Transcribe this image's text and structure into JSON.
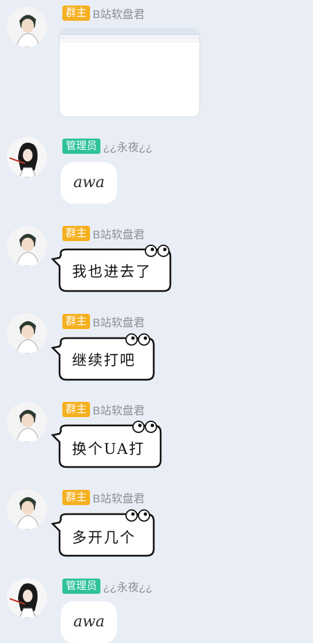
{
  "labels": {
    "owner": "群主",
    "admin": "管理员"
  },
  "users": {
    "owner_name": "B站软盘君",
    "admin_name": "¿¿永夜¿¿"
  },
  "messages": [
    {
      "id": "m1",
      "role": "owner",
      "type": "image"
    },
    {
      "id": "m2",
      "role": "admin",
      "type": "text",
      "text": "awa"
    },
    {
      "id": "m3",
      "role": "owner",
      "type": "sticker-bubble",
      "text": "我也进去了"
    },
    {
      "id": "m4",
      "role": "owner",
      "type": "sticker-bubble",
      "text": "继续打吧"
    },
    {
      "id": "m5",
      "role": "owner",
      "type": "sticker-bubble",
      "text": "换个UA打"
    },
    {
      "id": "m6",
      "role": "owner",
      "type": "sticker-bubble",
      "text": "多开几个"
    },
    {
      "id": "m7",
      "role": "admin",
      "type": "text",
      "text": "awa"
    }
  ],
  "colors": {
    "background": "#e9edf5",
    "owner_badge": "#f5b022",
    "admin_badge": "#2fc29b",
    "nick": "#8a8f99"
  }
}
